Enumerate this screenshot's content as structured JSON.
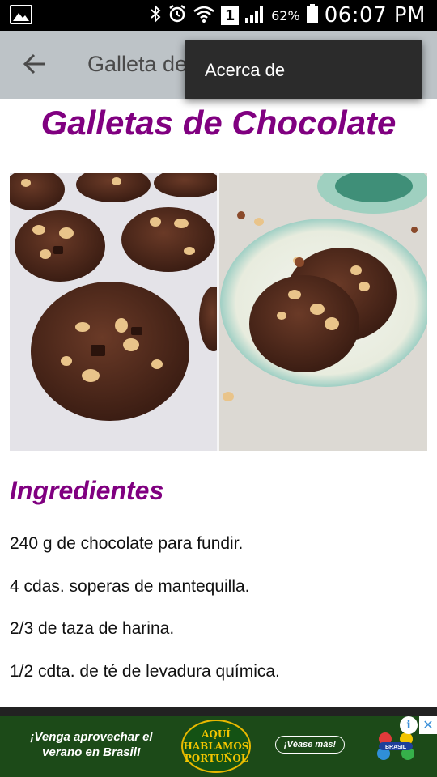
{
  "status_bar": {
    "battery_percent": "62%",
    "time": "06:07 PM",
    "sim_badge": "1",
    "icons": [
      "gallery-icon",
      "bluetooth-icon",
      "alarm-icon",
      "wifi-icon",
      "signal-icon",
      "battery-icon"
    ]
  },
  "app_bar": {
    "title": "Galleta de",
    "back_icon": "arrow-left-icon"
  },
  "overflow_menu": {
    "items": [
      {
        "label": "Acerca de"
      }
    ]
  },
  "recipe": {
    "title": "Galletas de Chocolate",
    "ingredients_heading": "Ingredientes",
    "ingredients": [
      "240 g de chocolate para fundir.",
      "4 cdas. soperas de mantequilla.",
      "2/3 de taza de harina.",
      "1/2 cdta. de té de levadura química."
    ]
  },
  "ad": {
    "headline": "¡Venga aprovechar el verano en Brasil!",
    "logo_text": "AQUÍ HABLAMOS PORTUÑOL",
    "cta": "¡Véase más!",
    "brand": "BRASIL",
    "info_icon": "info-icon",
    "close_icon": "close-icon"
  },
  "colors": {
    "accent": "#800080",
    "app_bar": "#bdc3c7",
    "status_bar": "#000000",
    "menu": "#2b2b2b"
  }
}
